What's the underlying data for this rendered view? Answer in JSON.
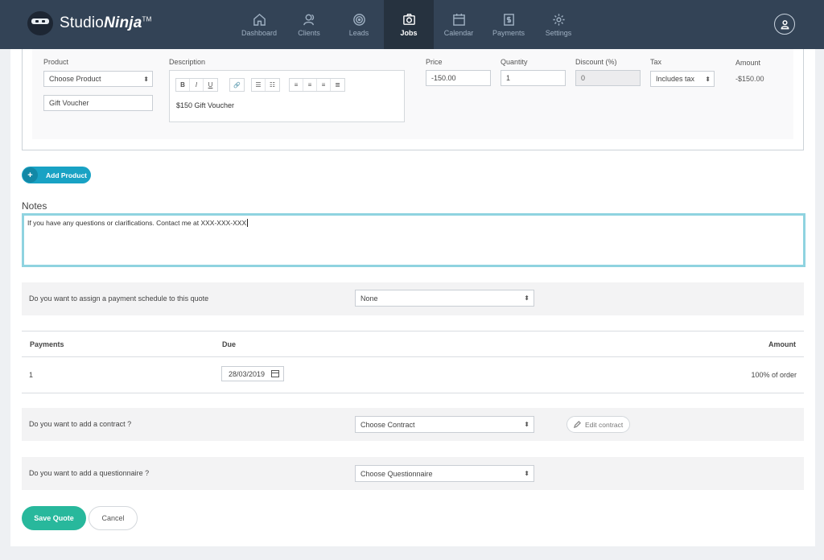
{
  "app": {
    "logo_text_a": "Studio",
    "logo_text_b": "Ninja",
    "logo_tm": "TM"
  },
  "nav": {
    "items": [
      {
        "label": "Dashboard",
        "icon": "home-icon"
      },
      {
        "label": "Clients",
        "icon": "users-icon"
      },
      {
        "label": "Leads",
        "icon": "target-icon"
      },
      {
        "label": "Jobs",
        "icon": "camera-icon",
        "active": true
      },
      {
        "label": "Calendar",
        "icon": "calendar-icon"
      },
      {
        "label": "Payments",
        "icon": "payments-icon"
      },
      {
        "label": "Settings",
        "icon": "gear-icon"
      }
    ]
  },
  "product": {
    "labels": {
      "product": "Product",
      "description": "Description",
      "price": "Price",
      "quantity": "Quantity",
      "discount": "Discount (%)",
      "tax": "Tax",
      "amount": "Amount"
    },
    "product_select": "Choose Product",
    "product_name": "Gift Voucher",
    "description_text": "$150 Gift Voucher",
    "toolbar": [
      "B",
      "I",
      "U",
      "link",
      "ul",
      "ol",
      "align-left",
      "align-center",
      "align-right",
      "justify"
    ],
    "toolbar_glyphs": {
      "bold": "B",
      "italic": "I",
      "underline": "U",
      "link": "🔗",
      "ul": "☰",
      "ol": "☷",
      "left": "≡",
      "center": "≡",
      "right": "≡",
      "justify": "≣"
    },
    "price": "-150.00",
    "quantity": "1",
    "discount": "0",
    "tax": "Includes tax",
    "amount": "-$150.00"
  },
  "add_product_label": "Add Product",
  "add_product_plus": "+",
  "notes": {
    "title": "Notes",
    "text": "If you have any questions or clarifications. Contact me at XXX-XXX-XXX"
  },
  "payment_schedule": {
    "question": "Do you want to assign a payment schedule to this quote",
    "value": "None"
  },
  "payments_table": {
    "headers": {
      "payments": "Payments",
      "due": "Due",
      "amount": "Amount"
    },
    "rows": [
      {
        "number": "1",
        "due": "28/03/2019",
        "amount": "100% of order"
      }
    ]
  },
  "contract": {
    "question": "Do you want to add a contract ?",
    "value": "Choose Contract",
    "edit_label": "Edit contract"
  },
  "questionnaire": {
    "question": "Do you want to add a questionnaire ?",
    "value": "Choose Questionnaire"
  },
  "actions": {
    "save": "Save Quote",
    "cancel": "Cancel"
  },
  "colors": {
    "topbar": "#334356",
    "active_nav": "#26323f",
    "accent_blue": "#19a2c4",
    "save_green": "#28b89c",
    "notes_border": "#8fd3e0"
  }
}
